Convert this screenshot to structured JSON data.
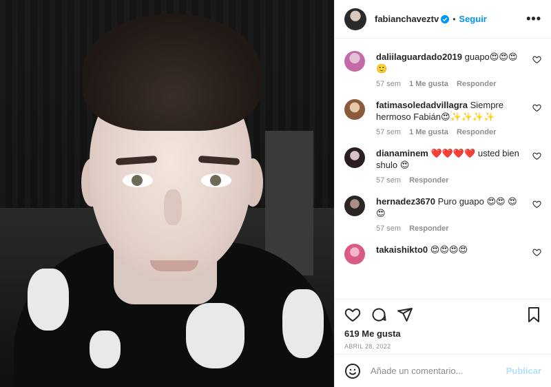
{
  "header": {
    "username": "fabianchaveztv",
    "dot": "•",
    "follow": "Seguir"
  },
  "comments": [
    {
      "user": "daliilaguardado2019",
      "text": "guapo😍😍😍 🙂",
      "time": "57 sem",
      "likes": "1 Me gusta",
      "reply": "Responder"
    },
    {
      "user": "fatimasoledadvillagra",
      "text": "Siempre hermoso Fabián😍✨✨✨✨",
      "time": "57 sem",
      "likes": "1 Me gusta",
      "reply": "Responder"
    },
    {
      "user": "dianaminem",
      "text": "❤️❤️❤️❤️ usted bien shulo 😍",
      "time": "57 sem",
      "likes": "",
      "reply": "Responder"
    },
    {
      "user": "hernadez3670",
      "text": "Puro guapo 😍😍 😍😍",
      "time": "57 sem",
      "likes": "",
      "reply": "Responder"
    },
    {
      "user": "takaishikto0",
      "text": "😍😍😍😍",
      "time": "",
      "likes": "",
      "reply": ""
    }
  ],
  "actions": {
    "likes": "619 Me gusta",
    "date": "ABRIL 28, 2022"
  },
  "add_comment": {
    "placeholder": "Añade un comentario...",
    "publish": "Publicar"
  },
  "icons": [
    "verified-icon",
    "more-icon",
    "heart-icon",
    "comment-icon",
    "share-icon",
    "bookmark-icon",
    "emoji-icon"
  ],
  "colors": {
    "link": "#0095f6",
    "muted": "#8e8e8e",
    "publish_disabled": "#b2dffc"
  }
}
